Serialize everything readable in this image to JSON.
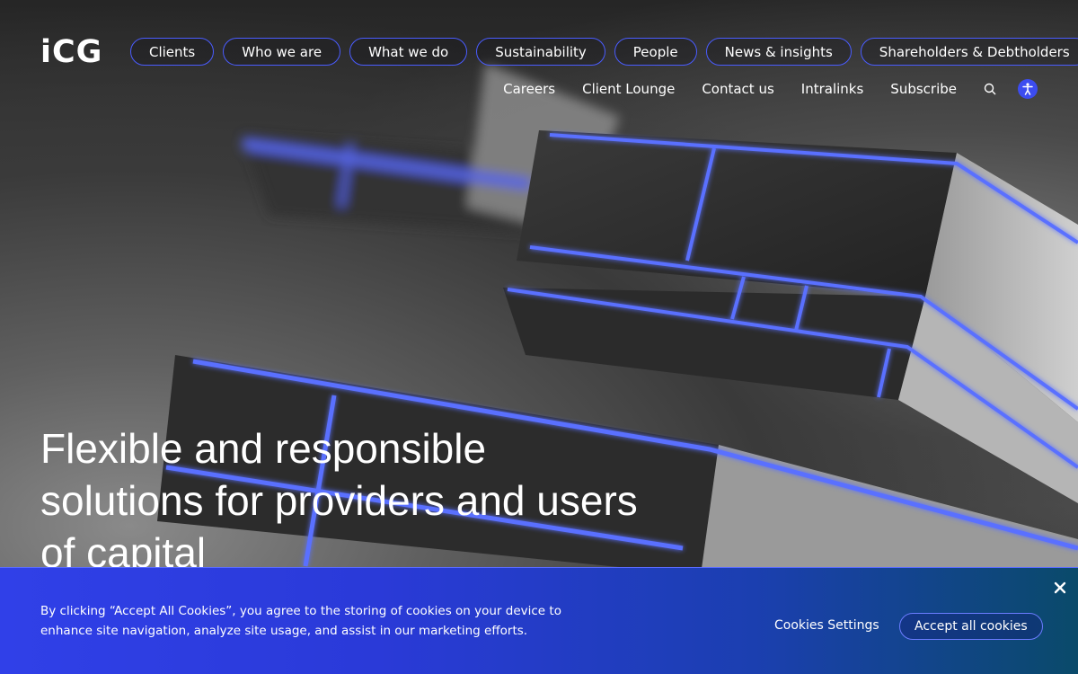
{
  "logo": {
    "text": "iCG"
  },
  "primary_nav": [
    {
      "label": "Clients"
    },
    {
      "label": "Who we are"
    },
    {
      "label": "What we do"
    },
    {
      "label": "Sustainability"
    },
    {
      "label": "People"
    },
    {
      "label": "News & insights"
    },
    {
      "label": "Shareholders & Debtholders"
    }
  ],
  "secondary_nav": [
    {
      "label": "Careers"
    },
    {
      "label": "Client Lounge"
    },
    {
      "label": "Contact us"
    },
    {
      "label": "Intralinks"
    },
    {
      "label": "Subscribe"
    }
  ],
  "icons": {
    "search": "search-icon",
    "accessibility": "accessibility-icon",
    "close": "close-icon"
  },
  "hero": {
    "headline_line1": "Flexible and responsible",
    "headline_line2": "solutions for providers and users",
    "headline_line3": "of capital"
  },
  "cookie_banner": {
    "text": "By clicking “Accept All Cookies”, you agree to the storing of cookies on your device to enhance site navigation, analyze site usage, and assist in our marketing efforts.",
    "settings_label": "Cookies Settings",
    "accept_label": "Accept all cookies"
  },
  "colors": {
    "accent": "#4a5cff",
    "banner_start": "#3040e8",
    "banner_end": "#0a4a6a"
  }
}
